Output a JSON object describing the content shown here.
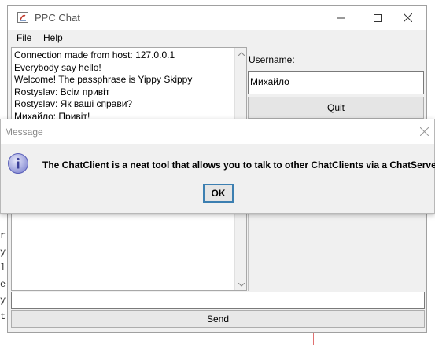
{
  "background": {
    "code_chars": [
      "r",
      "y",
      "l",
      "e",
      "y",
      "t"
    ]
  },
  "window": {
    "title": "PPC Chat",
    "menu": [
      "File",
      "Help"
    ],
    "chat_lines": [
      "Connection made from host: 127.0.0.1",
      "Everybody say hello!",
      "Welcome! The passphrase is Yippy Skippy",
      "Rostyslav: Всім привіт",
      "Rostyslav: Як ваші справи?",
      "Михайло: Привіт!"
    ],
    "username_label": "Username:",
    "username_value": "Михайло",
    "quit_label": "Quit",
    "message_value": "",
    "send_label": "Send"
  },
  "dialog": {
    "title": "Message",
    "message": "The ChatClient is a neat tool that allows you to talk to other ChatClients via a ChatServer",
    "ok_label": "OK",
    "icon": "info-icon"
  },
  "colors": {
    "dialog_icon": "#5a5fb8",
    "ok_border": "#3c7fb1"
  }
}
